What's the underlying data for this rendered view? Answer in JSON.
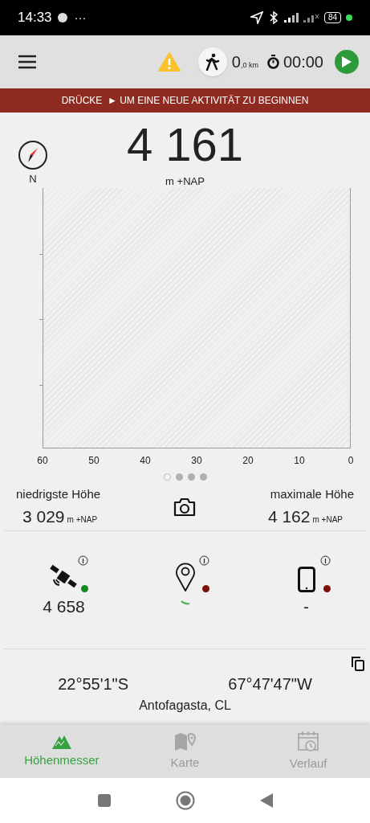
{
  "status_bar": {
    "time": "14:33",
    "more": "···",
    "battery": "84"
  },
  "toolbar": {
    "distance": "0",
    "distance_unit": ",0 km",
    "timer": "00:00"
  },
  "banner": {
    "text": "DRÜCKE  ► UM EINE NEUE AKTIVITÄT ZU BEGINNEN"
  },
  "compass": {
    "label": "N"
  },
  "altitude": {
    "value": "4 161",
    "unit": "m +NAP"
  },
  "chart": {
    "x_labels": [
      "60",
      "50",
      "40",
      "30",
      "20",
      "10",
      "0"
    ]
  },
  "pages": [
    {
      "selected": true
    },
    {
      "selected": false
    },
    {
      "selected": false
    },
    {
      "selected": false
    }
  ],
  "lowest": {
    "label": "niedrigste Höhe",
    "value": "3 029",
    "unit": "m +NAP"
  },
  "highest": {
    "label": "maximale Höhe",
    "value": "4 162",
    "unit": "m +NAP"
  },
  "sensors": [
    {
      "kind": "satellite",
      "color": "#118a1e",
      "reading": "4 658"
    },
    {
      "kind": "location",
      "color": "#7a1208",
      "loading": true
    },
    {
      "kind": "phone",
      "color": "#7a1208",
      "reading": "-"
    }
  ],
  "coordinates": {
    "latitude": "22°55'1\"S",
    "longitude": "67°47'47\"W",
    "place": "Antofagasta, CL"
  },
  "bottom_nav": [
    {
      "label": "Höhenmesser",
      "kind": "mountain",
      "selected": true
    },
    {
      "label": "Karte",
      "kind": "map",
      "selected": false
    },
    {
      "label": "Verlauf",
      "kind": "history",
      "selected": false
    }
  ]
}
